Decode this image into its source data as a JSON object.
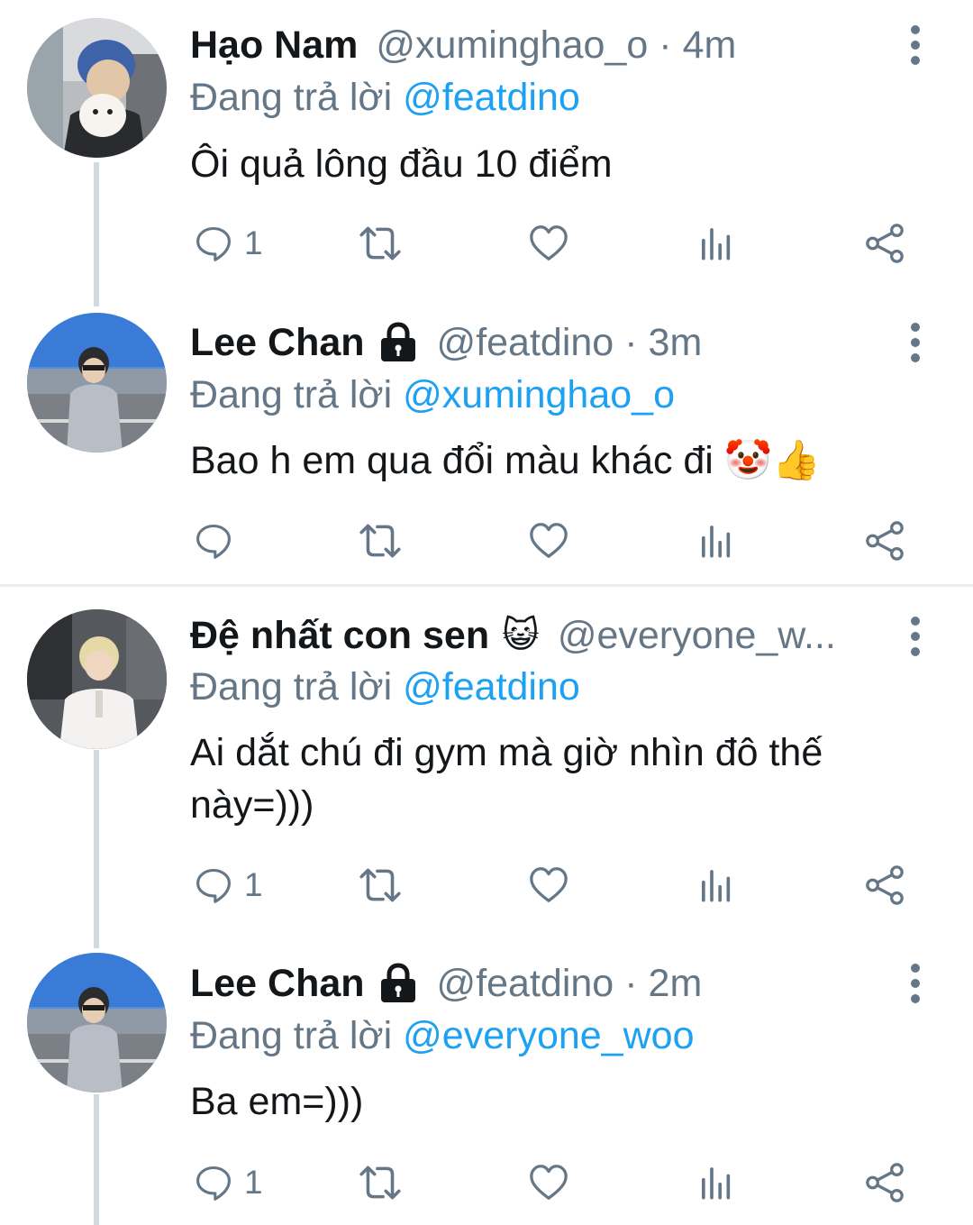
{
  "tweets": [
    {
      "name": "Hạo Nam",
      "locked": false,
      "badge_emoji": "",
      "handle": "@xuminghao_o",
      "separator": "·",
      "time": "4m",
      "reply_prefix": "Đang trả lời",
      "reply_to": "@featdino",
      "text": "Ôi quả lông đầu 10 điểm",
      "reply_count": "1"
    },
    {
      "name": "Lee Chan",
      "locked": true,
      "badge_emoji": "",
      "handle": "@featdino",
      "separator": "·",
      "time": "3m",
      "reply_prefix": "Đang trả lời",
      "reply_to": "@xuminghao_o",
      "text": "Bao h em qua đổi màu khác đi 🤡👍",
      "reply_count": ""
    },
    {
      "name": "Đệ nhất con sen",
      "locked": false,
      "badge_emoji": "😺",
      "handle": "@everyone_w...",
      "separator": "",
      "time": "",
      "reply_prefix": "Đang trả lời",
      "reply_to": "@featdino",
      "text": "Ai dắt chú đi gym mà giờ nhìn đô thế này=)))",
      "reply_count": "1"
    },
    {
      "name": "Lee Chan",
      "locked": true,
      "badge_emoji": "",
      "handle": "@featdino",
      "separator": "·",
      "time": "2m",
      "reply_prefix": "Đang trả lời",
      "reply_to": "@everyone_woo",
      "text": "Ba em=)))",
      "reply_count": "1"
    }
  ],
  "colors": {
    "text": "#14171a",
    "secondary": "#657786",
    "link": "#1da1f2",
    "thread_line": "#cfd9de",
    "divider": "#e6ecf0"
  },
  "icons": [
    "reply-icon",
    "retweet-icon",
    "like-icon",
    "analytics-icon",
    "share-icon",
    "more-icon",
    "lock-icon"
  ]
}
